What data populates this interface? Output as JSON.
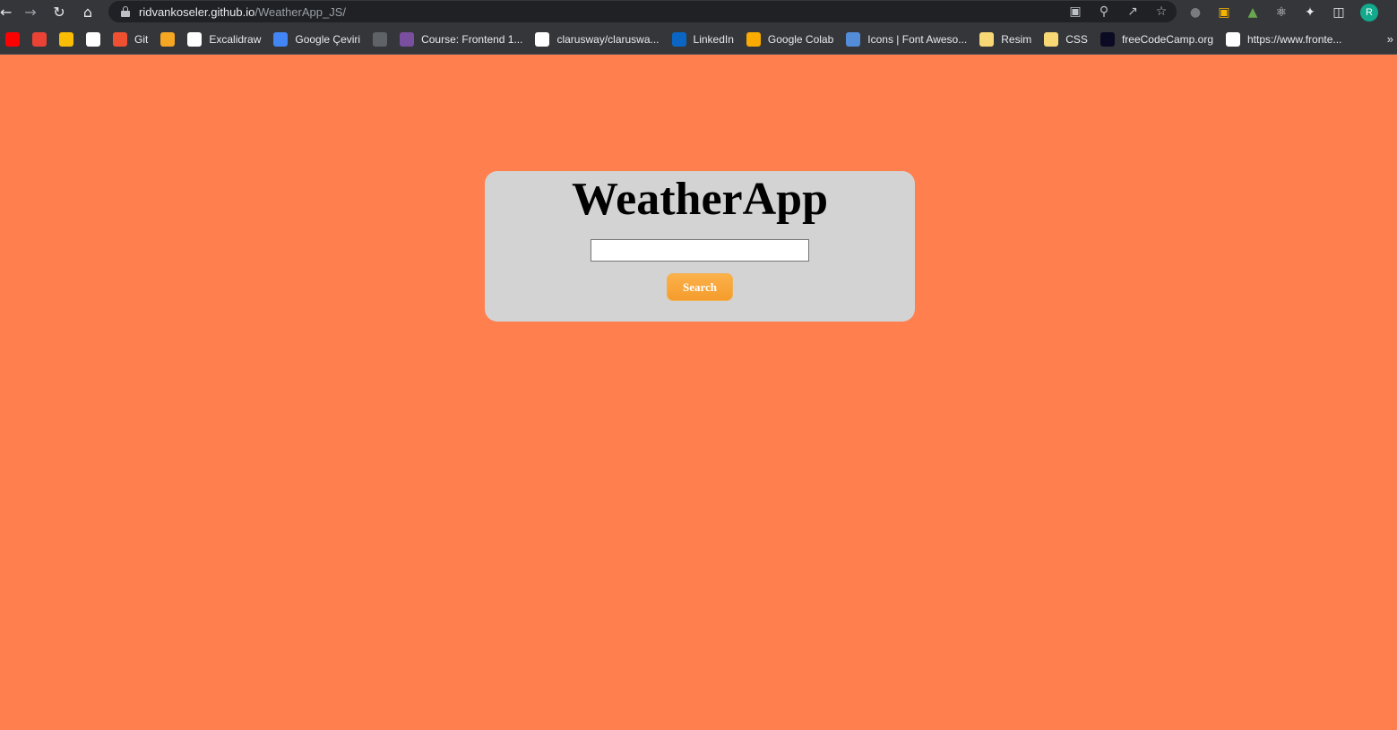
{
  "browser": {
    "url_host": "ridvankoseler.github.io",
    "url_path": "/WeatherApp_JS/",
    "profile_initial": "R",
    "bookmarks": [
      {
        "label": "",
        "icon": "youtube-icon",
        "color": "#ff0000"
      },
      {
        "label": "",
        "icon": "gmail-icon",
        "color": "#ea4335"
      },
      {
        "label": "",
        "icon": "google-drive-icon",
        "color": "#fbbc04"
      },
      {
        "label": "",
        "icon": "github-icon",
        "color": "#ffffff"
      },
      {
        "label": "Git",
        "icon": "git-icon",
        "color": "#f05032"
      },
      {
        "label": "",
        "icon": "bookmark-card-icon",
        "color": "#f5a623"
      },
      {
        "label": "Excalidraw",
        "icon": "excalidraw-icon",
        "color": "#ffffff"
      },
      {
        "label": "Google Çeviri",
        "icon": "google-translate-icon",
        "color": "#4285f4"
      },
      {
        "label": "",
        "icon": "globe-icon",
        "color": "#5f6368"
      },
      {
        "label": "Course: Frontend 1...",
        "icon": "course-icon",
        "color": "#7b4fa0"
      },
      {
        "label": "clarusway/claruswa...",
        "icon": "github-icon",
        "color": "#ffffff"
      },
      {
        "label": "LinkedIn",
        "icon": "linkedin-icon",
        "color": "#0a66c2"
      },
      {
        "label": "Google Colab",
        "icon": "colab-icon",
        "color": "#f9ab00"
      },
      {
        "label": "Icons | Font Aweso...",
        "icon": "font-awesome-flag-icon",
        "color": "#538dd7"
      },
      {
        "label": "Resim",
        "icon": "folder-icon",
        "color": "#f8d775"
      },
      {
        "label": "CSS",
        "icon": "folder-icon",
        "color": "#f8d775"
      },
      {
        "label": "freeCodeCamp.org",
        "icon": "freecodecamp-icon",
        "color": "#0a0a23"
      },
      {
        "label": "https://www.fronte...",
        "icon": "page-icon",
        "color": "#ffffff"
      }
    ]
  },
  "app": {
    "title": "WeatherApp",
    "input_value": "",
    "search_label": "Search"
  }
}
